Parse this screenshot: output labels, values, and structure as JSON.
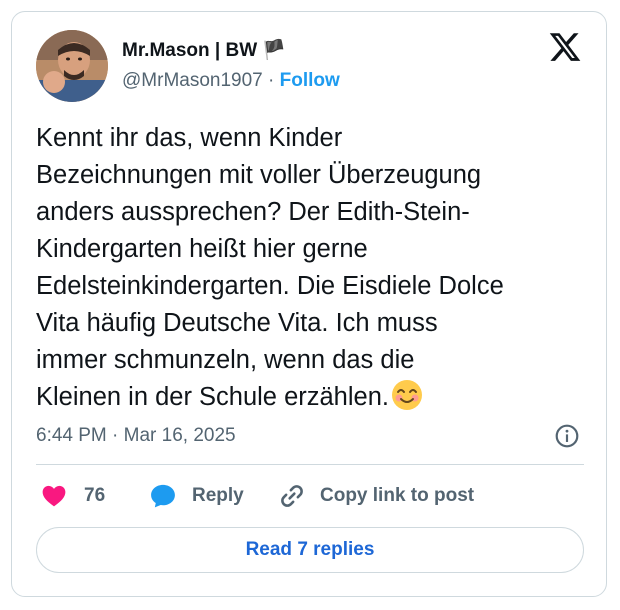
{
  "author": {
    "display_name": "Mr.Mason | BW 🏴",
    "handle": "@MrMason1907",
    "separator": "·",
    "follow_label": "Follow"
  },
  "tweet": {
    "lines": [
      "Kennt ihr das, wenn Kinder",
      "Bezeichnungen mit voller Überzeugung",
      "anders aussprechen? Der Edith-Stein-",
      "Kindergarten heißt hier gerne",
      "Edelsteinkindergarten. Die Eisdiele Dolce",
      "Vita häufig Deutsche Vita. Ich muss",
      "immer schmunzeln, wenn das die",
      "Kleinen in der Schule erzählen."
    ],
    "emoji": "smiling-face-with-smiling-eyes"
  },
  "meta": {
    "time": "6:44 PM",
    "separator": "·",
    "date": "Mar 16, 2025"
  },
  "actions": {
    "like_count": "76",
    "reply_label": "Reply",
    "copy_label": "Copy link to post"
  },
  "footer": {
    "read_replies_label": "Read 7 replies"
  },
  "colors": {
    "heart": "#f91880",
    "reply_bubble": "#1d9bf0",
    "link_blue": "#1d9bf0",
    "replies_button_text": "#1d67d6",
    "secondary_text": "#536471",
    "border": "#cfd9de"
  }
}
